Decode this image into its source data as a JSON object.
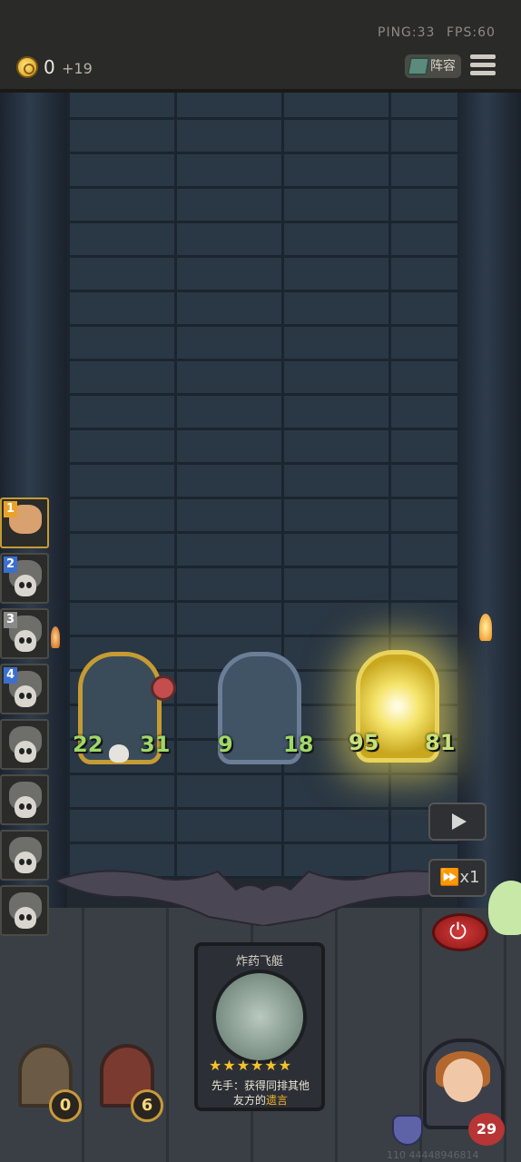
{
  "hud": {
    "ping": "PING:33",
    "fps": "FPS:60",
    "gold": "0",
    "gold_income": "+19",
    "lineup_label": "阵容"
  },
  "turn_order": [
    {
      "num": "1",
      "num_color": "#e8a22a"
    },
    {
      "num": "2",
      "num_color": "#3b6fd0"
    },
    {
      "num": "3",
      "num_color": "#8a8a8a"
    },
    {
      "num": "4",
      "num_color": "#3b6fd0"
    },
    {
      "num": "",
      "num_color": ""
    },
    {
      "num": "",
      "num_color": ""
    },
    {
      "num": "",
      "num_color": ""
    },
    {
      "num": "",
      "num_color": ""
    }
  ],
  "board": [
    {
      "name": "robot-unit",
      "attack": "22",
      "health": "31",
      "frame": "gold"
    },
    {
      "name": "airship-unit",
      "attack": "9",
      "health": "18",
      "frame": "steel"
    },
    {
      "name": "glowing-unit",
      "attack": "95",
      "health": "81",
      "frame": "glow"
    }
  ],
  "controls": {
    "speed": "x1"
  },
  "hand_card": {
    "title": "炸药飞艇",
    "stars": "★★★★★★",
    "desc_prefix": "先手：获得同排其他",
    "desc_line2_prefix": "友方的",
    "desc_keyword": "遗言"
  },
  "bottom": {
    "box1_count": "0",
    "box2_count": "6",
    "hero_health": "29",
    "uid": "110 44448946814"
  }
}
